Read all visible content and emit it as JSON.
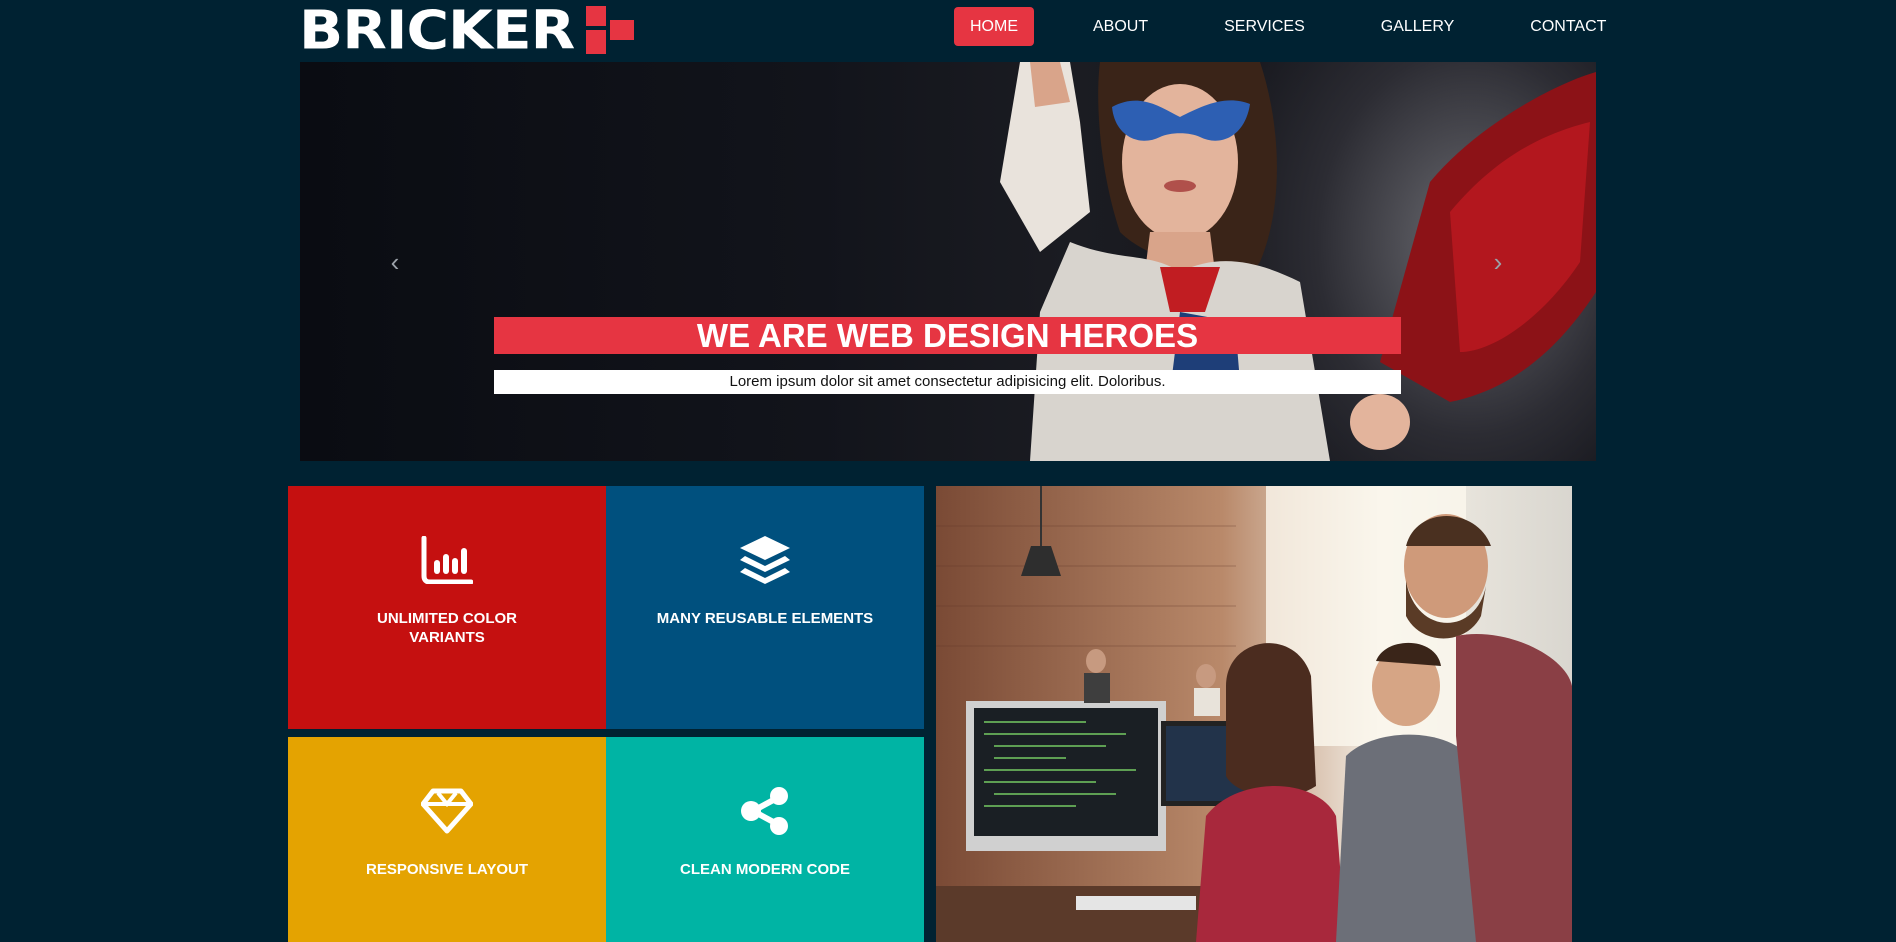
{
  "brand": {
    "name": "BRICKER",
    "accent": "#e63542"
  },
  "nav": {
    "items": [
      "HOME",
      "ABOUT",
      "SERVICES",
      "GALLERY",
      "CONTACT"
    ],
    "active": "HOME"
  },
  "hero": {
    "title": "WE ARE WEB DESIGN HEROES",
    "subtitle": "Lorem ipsum dolor sit amet consectetur adipisicing elit. Doloribus.",
    "prev_icon": "chevron-left-icon",
    "next_icon": "chevron-right-icon"
  },
  "features": [
    {
      "label": "UNLIMITED COLOR VARIANTS",
      "icon": "bar-chart-icon",
      "color": "#c51010"
    },
    {
      "label": "MANY REUSABLE ELEMENTS",
      "icon": "layers-icon",
      "color": "#00507e"
    },
    {
      "label": "RESPONSIVE LAYOUT",
      "icon": "diamond-icon",
      "color": "#e4a301"
    },
    {
      "label": "CLEAN MODERN CODE",
      "icon": "share-icon",
      "color": "#00b4a4"
    }
  ],
  "colors": {
    "background": "#002232"
  }
}
